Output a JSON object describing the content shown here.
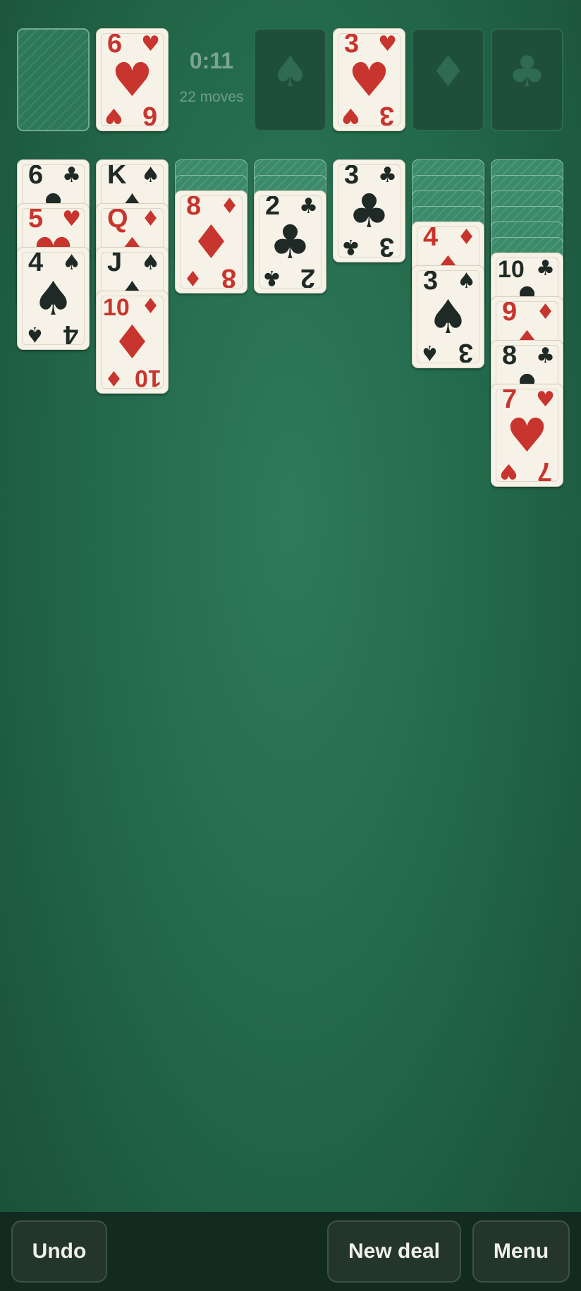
{
  "status": {
    "timer": "0:11",
    "moves": "22 moves"
  },
  "stock": {
    "icon": "card-back-pattern"
  },
  "waste": {
    "top_card": {
      "rank": "6",
      "suit": "♥",
      "color": "red"
    }
  },
  "foundations": [
    {
      "label": "spades",
      "empty_icon": "♠"
    },
    {
      "label": "hearts",
      "top_card": {
        "rank": "3",
        "suit": "♥",
        "color": "red"
      }
    },
    {
      "label": "diamonds",
      "empty_icon": "♦"
    },
    {
      "label": "clubs",
      "empty_icon": "♣"
    }
  ],
  "tableau": [
    {
      "facedown": 0,
      "faceup": [
        {
          "rank": "6",
          "suit": "♣",
          "color": "black"
        },
        {
          "rank": "5",
          "suit": "♥",
          "color": "red"
        },
        {
          "rank": "4",
          "suit": "♠",
          "color": "black"
        }
      ]
    },
    {
      "facedown": 0,
      "faceup": [
        {
          "rank": "K",
          "suit": "♠",
          "color": "black"
        },
        {
          "rank": "Q",
          "suit": "♦",
          "color": "red"
        },
        {
          "rank": "J",
          "suit": "♠",
          "color": "black"
        },
        {
          "rank": "10",
          "suit": "♦",
          "color": "red"
        }
      ]
    },
    {
      "facedown": 2,
      "faceup": [
        {
          "rank": "8",
          "suit": "♦",
          "color": "red"
        }
      ]
    },
    {
      "facedown": 2,
      "faceup": [
        {
          "rank": "2",
          "suit": "♣",
          "color": "black"
        }
      ]
    },
    {
      "facedown": 0,
      "faceup": [
        {
          "rank": "3",
          "suit": "♣",
          "color": "black"
        }
      ]
    },
    {
      "facedown": 4,
      "faceup": [
        {
          "rank": "4",
          "suit": "♦",
          "color": "red"
        },
        {
          "rank": "3",
          "suit": "♠",
          "color": "black"
        }
      ]
    },
    {
      "facedown": 6,
      "faceup": [
        {
          "rank": "10",
          "suit": "♣",
          "color": "black"
        },
        {
          "rank": "9",
          "suit": "♦",
          "color": "red"
        },
        {
          "rank": "8",
          "suit": "♣",
          "color": "black"
        },
        {
          "rank": "7",
          "suit": "♥",
          "color": "red"
        }
      ]
    }
  ],
  "buttons": {
    "undo": "Undo",
    "new_deal": "New deal",
    "menu": "Menu"
  },
  "colors": {
    "felt": "#236a4b",
    "card": "#f6f2e7",
    "red_suit": "#c8352e",
    "black_suit": "#1f2a26"
  }
}
